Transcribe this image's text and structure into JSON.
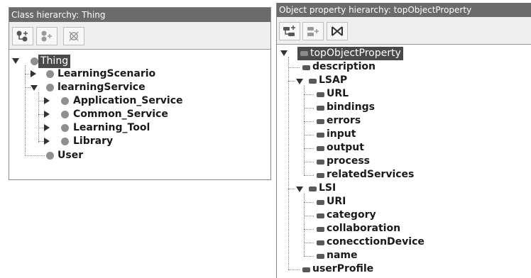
{
  "left_panel": {
    "title": "Class hierarchy: Thing",
    "toolbar": {
      "add_subclass_icon": "add-subclass-icon",
      "add_sibling_icon": "add-sibling-icon",
      "delete_icon": "delete-class-icon"
    },
    "tree": {
      "root": "Thing",
      "items": [
        "LearningScenario",
        "learningService",
        "Application_Service",
        "Common_Service",
        "Learning_Tool",
        "Library",
        "User"
      ]
    }
  },
  "right_panel": {
    "title": "Object property hierarchy: topObjectProperty",
    "toolbar": {
      "add_subproperty_icon": "add-subproperty-icon",
      "add_sibling_icon": "add-sibling-property-icon",
      "delete_icon": "delete-property-icon"
    },
    "tree": {
      "root": "topObjectProperty",
      "items": [
        "description",
        "LSAP",
        "URL",
        "bindings",
        "errors",
        "input",
        "output",
        "process",
        "relatedServices",
        "LSI",
        "URI",
        "category",
        "collaboration",
        "conecctionDevice",
        "name",
        "userProfile"
      ]
    }
  }
}
